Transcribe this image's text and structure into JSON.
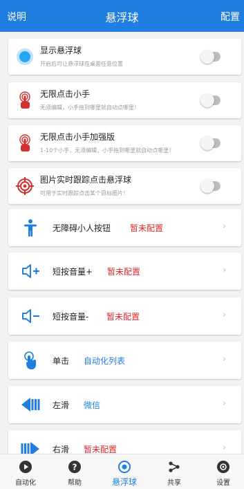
{
  "header": {
    "left": "说明",
    "title": "悬浮球",
    "right": "配置"
  },
  "colors": {
    "accent": "#1f7ee0",
    "danger": "#d9282f",
    "icon_red": "#d32f2f"
  },
  "toggles": [
    {
      "title": "显示悬浮球",
      "subtitle": "开启后可让悬浮球在桌面任意位置",
      "icon": "bubble-icon",
      "enabled": false
    },
    {
      "title": "无限点击小手",
      "subtitle": "无须编辑，小手拖到哪里就自动点哪里！",
      "icon": "tap-hand-icon",
      "enabled": false
    },
    {
      "title": "无限点击小手加强版",
      "subtitle": "1-10个小手，无须编辑，小手拖到哪里就自动点哪里！",
      "icon": "tap-hand-plus-icon",
      "enabled": false
    },
    {
      "title": "图片实时跟踪点击悬浮球",
      "subtitle": "可用于实时跟踪点击某个目标图片！",
      "icon": "target-icon",
      "enabled": false
    }
  ],
  "actions": [
    {
      "label": "无障碍小人按钮",
      "value": "暂未配置",
      "status": "unset",
      "icon": "accessibility-icon"
    },
    {
      "label": "短按音量+",
      "value": "暂未配置",
      "status": "unset",
      "icon": "volume-up-icon"
    },
    {
      "label": "短按音量-",
      "value": "暂未配置",
      "status": "unset",
      "icon": "volume-down-icon"
    },
    {
      "label": "单击",
      "value": "自动化列表",
      "status": "set",
      "icon": "single-tap-icon"
    },
    {
      "label": "左滑",
      "value": "微信",
      "status": "set",
      "icon": "swipe-left-icon"
    },
    {
      "label": "右滑",
      "value": "暂未配置",
      "status": "unset",
      "icon": "swipe-right-icon"
    }
  ],
  "chevron": "›",
  "tabs": [
    {
      "label": "自动化",
      "icon": "play-icon",
      "active": false
    },
    {
      "label": "帮助",
      "icon": "help-icon",
      "active": false
    },
    {
      "label": "悬浮球",
      "icon": "float-ball-icon",
      "active": true
    },
    {
      "label": "共享",
      "icon": "share-icon",
      "active": false
    },
    {
      "label": "设置",
      "icon": "settings-icon",
      "active": false
    }
  ]
}
